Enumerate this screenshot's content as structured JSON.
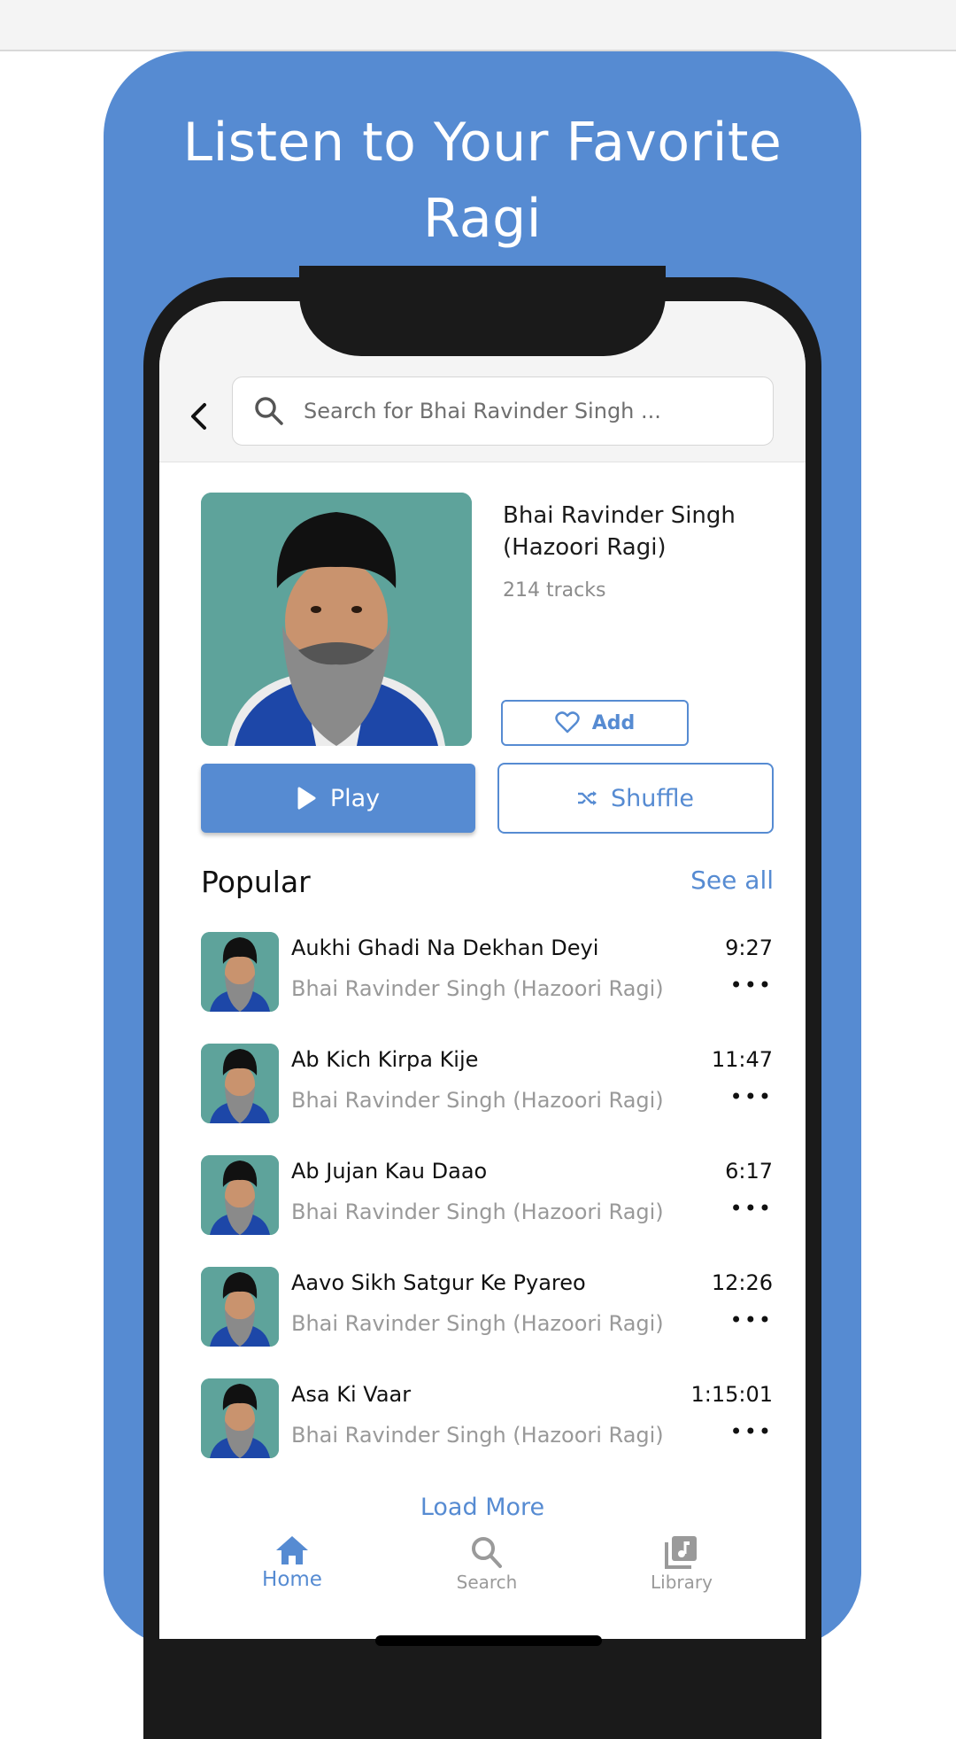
{
  "headline": {
    "line1": "Listen to Your Favorite",
    "line2": "Ragi"
  },
  "colors": {
    "accent": "#568bd2",
    "image_bg": "#5ea39b",
    "secondary_text": "#999999"
  },
  "search": {
    "placeholder": "Search for Bhai Ravinder Singh ..."
  },
  "artist": {
    "name_line1": "Bhai Ravinder Singh",
    "name_line2": "(Hazoori Ragi)",
    "track_count": "214 tracks",
    "add_label": "Add"
  },
  "actions": {
    "play_label": "Play",
    "shuffle_label": "Shuffle"
  },
  "popular": {
    "title": "Popular",
    "see_all": "See all",
    "tracks": [
      {
        "title": "Aukhi Ghadi Na Dekhan Deyi",
        "artist": "Bhai Ravinder Singh (Hazoori Ragi)",
        "duration": "9:27"
      },
      {
        "title": "Ab Kich Kirpa Kije",
        "artist": "Bhai Ravinder Singh (Hazoori Ragi)",
        "duration": "11:47"
      },
      {
        "title": "Ab Jujan Kau Daao",
        "artist": "Bhai Ravinder Singh (Hazoori Ragi)",
        "duration": "6:17"
      },
      {
        "title": "Aavo Sikh Satgur Ke Pyareo",
        "artist": "Bhai Ravinder Singh (Hazoori Ragi)",
        "duration": "12:26"
      },
      {
        "title": "Asa Ki Vaar",
        "artist": "Bhai Ravinder Singh (Hazoori Ragi)",
        "duration": "1:15:01"
      }
    ],
    "more_glyph": "•••",
    "load_more": "Load More"
  },
  "tabs": [
    {
      "label": "Home",
      "icon": "home-icon",
      "active": true
    },
    {
      "label": "Search",
      "icon": "search-icon",
      "active": false
    },
    {
      "label": "Library",
      "icon": "library-music-icon",
      "active": false
    }
  ]
}
